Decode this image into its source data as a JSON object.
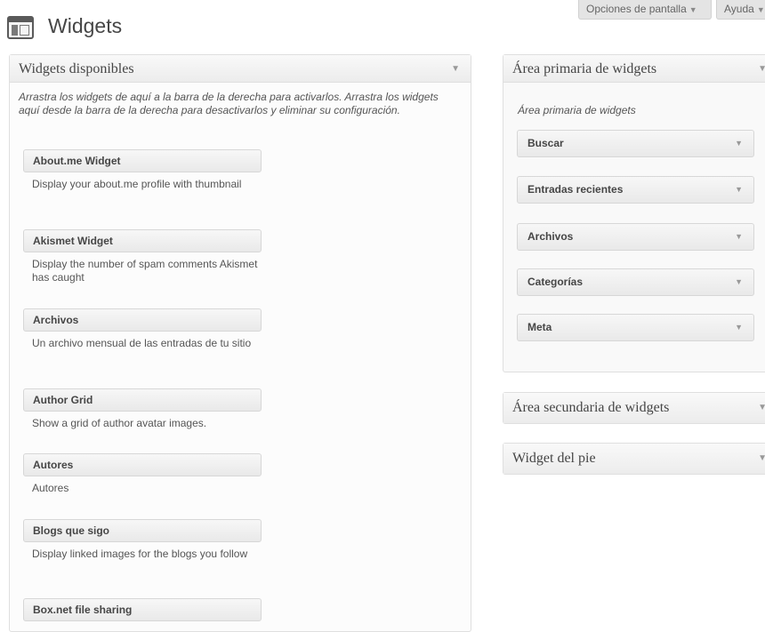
{
  "header": {
    "title": "Widgets",
    "screen_options": "Opciones de pantalla",
    "help": "Ayuda"
  },
  "available": {
    "title": "Widgets disponibles",
    "description": "Arrastra los widgets de aquí a la barra de la derecha para activarlos. Arrastra los widgets aquí desde la barra de la derecha para desactivarlos y eliminar su configuración.",
    "widgets": [
      {
        "name": "About.me Widget",
        "desc": "Display your about.me profile with thumbnail"
      },
      {
        "name": "Akismet Widget",
        "desc": "Display the number of spam comments Akismet has caught"
      },
      {
        "name": "Archivos",
        "desc": "Un archivo mensual de las entradas de tu sitio"
      },
      {
        "name": "Author Grid",
        "desc": "Show a grid of author avatar images."
      },
      {
        "name": "Autores",
        "desc": "Autores"
      },
      {
        "name": "Blogs que sigo",
        "desc": "Display linked images for the blogs you follow"
      },
      {
        "name": "Box.net file sharing",
        "desc": ""
      }
    ]
  },
  "primary": {
    "title": "Área primaria de widgets",
    "description": "Área primaria de widgets",
    "widgets": [
      "Buscar",
      "Entradas recientes",
      "Archivos",
      "Categorías",
      "Meta"
    ]
  },
  "secondary": {
    "title": "Área secundaria de widgets"
  },
  "footer_area": {
    "title": "Widget del pie"
  }
}
